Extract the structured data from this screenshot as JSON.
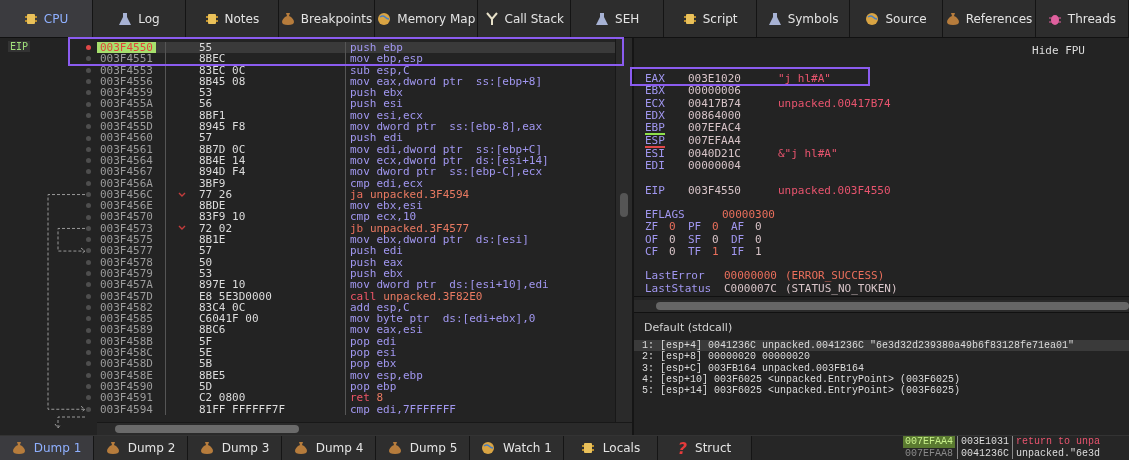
{
  "tabs": [
    {
      "label": "CPU",
      "selected": true
    },
    {
      "label": "Log",
      "selected": false
    },
    {
      "label": "Notes",
      "selected": false
    },
    {
      "label": "Breakpoints",
      "selected": false
    },
    {
      "label": "Memory Map",
      "selected": false
    },
    {
      "label": "Call Stack",
      "selected": false
    },
    {
      "label": "SEH",
      "selected": false
    },
    {
      "label": "Script",
      "selected": false
    },
    {
      "label": "Symbols",
      "selected": false
    },
    {
      "label": "Source",
      "selected": false
    },
    {
      "label": "References",
      "selected": false
    },
    {
      "label": "Threads",
      "selected": false
    }
  ],
  "disassembly": {
    "eip_label": "EIP",
    "rows": [
      {
        "address": "003F4550",
        "bytes": "55",
        "mnemonic": "push",
        "operands": "ebp",
        "kind": "plain",
        "breakpoint": true,
        "current": true,
        "jump_marker": false
      },
      {
        "address": "003F4551",
        "bytes": "8BEC",
        "mnemonic": "mov",
        "operands": "ebp,esp",
        "kind": "plain",
        "breakpoint": false,
        "current": false,
        "jump_marker": false
      },
      {
        "address": "003F4553",
        "bytes": "83EC 0C",
        "mnemonic": "sub",
        "operands": "esp,C",
        "kind": "plain",
        "breakpoint": false,
        "current": false,
        "jump_marker": false
      },
      {
        "address": "003F4556",
        "bytes": "8B45 08",
        "mnemonic": "mov",
        "operands": "eax,dword ptr  ss:[ebp+8]",
        "kind": "plain",
        "breakpoint": false,
        "current": false,
        "jump_marker": false
      },
      {
        "address": "003F4559",
        "bytes": "53",
        "mnemonic": "push",
        "operands": "ebx",
        "kind": "plain",
        "breakpoint": false,
        "current": false,
        "jump_marker": false
      },
      {
        "address": "003F455A",
        "bytes": "56",
        "mnemonic": "push",
        "operands": "esi",
        "kind": "plain",
        "breakpoint": false,
        "current": false,
        "jump_marker": false
      },
      {
        "address": "003F455B",
        "bytes": "8BF1",
        "mnemonic": "mov",
        "operands": "esi,ecx",
        "kind": "plain",
        "breakpoint": false,
        "current": false,
        "jump_marker": false
      },
      {
        "address": "003F455D",
        "bytes": "8945 F8",
        "mnemonic": "mov",
        "operands": "dword ptr  ss:[ebp-8],eax",
        "kind": "plain",
        "breakpoint": false,
        "current": false,
        "jump_marker": false
      },
      {
        "address": "003F4560",
        "bytes": "57",
        "mnemonic": "push",
        "operands": "edi",
        "kind": "plain",
        "breakpoint": false,
        "current": false,
        "jump_marker": false
      },
      {
        "address": "003F4561",
        "bytes": "8B7D 0C",
        "mnemonic": "mov",
        "operands": "edi,dword ptr  ss:[ebp+C]",
        "kind": "plain",
        "breakpoint": false,
        "current": false,
        "jump_marker": false
      },
      {
        "address": "003F4564",
        "bytes": "8B4E 14",
        "mnemonic": "mov",
        "operands": "ecx,dword ptr  ds:[esi+14]",
        "kind": "plain",
        "breakpoint": false,
        "current": false,
        "jump_marker": false
      },
      {
        "address": "003F4567",
        "bytes": "894D F4",
        "mnemonic": "mov",
        "operands": "dword ptr  ss:[ebp-C],ecx",
        "kind": "plain",
        "breakpoint": false,
        "current": false,
        "jump_marker": false
      },
      {
        "address": "003F456A",
        "bytes": "3BF9",
        "mnemonic": "cmp",
        "operands": "edi,ecx",
        "kind": "plain",
        "breakpoint": false,
        "current": false,
        "jump_marker": false
      },
      {
        "address": "003F456C",
        "bytes": "77 26",
        "mnemonic": "ja",
        "operands": "unpacked.3F4594",
        "kind": "jump",
        "breakpoint": false,
        "current": false,
        "jump_marker": true
      },
      {
        "address": "003F456E",
        "bytes": "8BDE",
        "mnemonic": "mov",
        "operands": "ebx,esi",
        "kind": "plain",
        "breakpoint": false,
        "current": false,
        "jump_marker": false
      },
      {
        "address": "003F4570",
        "bytes": "83F9 10",
        "mnemonic": "cmp",
        "operands": "ecx,10",
        "kind": "plain",
        "breakpoint": false,
        "current": false,
        "jump_marker": false
      },
      {
        "address": "003F4573",
        "bytes": "72 02",
        "mnemonic": "jb",
        "operands": "unpacked.3F4577",
        "kind": "jump",
        "breakpoint": false,
        "current": false,
        "jump_marker": true
      },
      {
        "address": "003F4575",
        "bytes": "8B1E",
        "mnemonic": "mov",
        "operands": "ebx,dword ptr  ds:[esi]",
        "kind": "plain",
        "breakpoint": false,
        "current": false,
        "jump_marker": false
      },
      {
        "address": "003F4577",
        "bytes": "57",
        "mnemonic": "push",
        "operands": "edi",
        "kind": "plain",
        "breakpoint": false,
        "current": false,
        "jump_marker": false
      },
      {
        "address": "003F4578",
        "bytes": "50",
        "mnemonic": "push",
        "operands": "eax",
        "kind": "plain",
        "breakpoint": false,
        "current": false,
        "jump_marker": false
      },
      {
        "address": "003F4579",
        "bytes": "53",
        "mnemonic": "push",
        "operands": "ebx",
        "kind": "plain",
        "breakpoint": false,
        "current": false,
        "jump_marker": false
      },
      {
        "address": "003F457A",
        "bytes": "897E 10",
        "mnemonic": "mov",
        "operands": "dword ptr  ds:[esi+10],edi",
        "kind": "plain",
        "breakpoint": false,
        "current": false,
        "jump_marker": false
      },
      {
        "address": "003F457D",
        "bytes": "E8 5E3D0000",
        "mnemonic": "call",
        "operands": "unpacked.3F82E0",
        "kind": "call",
        "breakpoint": false,
        "current": false,
        "jump_marker": false
      },
      {
        "address": "003F4582",
        "bytes": "83C4 0C",
        "mnemonic": "add",
        "operands": "esp,C",
        "kind": "plain",
        "breakpoint": false,
        "current": false,
        "jump_marker": false
      },
      {
        "address": "003F4585",
        "bytes": "C6041F 00",
        "mnemonic": "mov",
        "operands": "byte ptr  ds:[edi+ebx],0",
        "kind": "plain",
        "breakpoint": false,
        "current": false,
        "jump_marker": false
      },
      {
        "address": "003F4589",
        "bytes": "8BC6",
        "mnemonic": "mov",
        "operands": "eax,esi",
        "kind": "plain",
        "breakpoint": false,
        "current": false,
        "jump_marker": false
      },
      {
        "address": "003F458B",
        "bytes": "5F",
        "mnemonic": "pop",
        "operands": "edi",
        "kind": "plain",
        "breakpoint": false,
        "current": false,
        "jump_marker": false
      },
      {
        "address": "003F458C",
        "bytes": "5E",
        "mnemonic": "pop",
        "operands": "esi",
        "kind": "plain",
        "breakpoint": false,
        "current": false,
        "jump_marker": false
      },
      {
        "address": "003F458D",
        "bytes": "5B",
        "mnemonic": "pop",
        "operands": "ebx",
        "kind": "plain",
        "breakpoint": false,
        "current": false,
        "jump_marker": false
      },
      {
        "address": "003F458E",
        "bytes": "8BE5",
        "mnemonic": "mov",
        "operands": "esp,ebp",
        "kind": "plain",
        "breakpoint": false,
        "current": false,
        "jump_marker": false
      },
      {
        "address": "003F4590",
        "bytes": "5D",
        "mnemonic": "pop",
        "operands": "ebp",
        "kind": "plain",
        "breakpoint": false,
        "current": false,
        "jump_marker": false
      },
      {
        "address": "003F4591",
        "bytes": "C2 0800",
        "mnemonic": "ret",
        "operands": "8",
        "kind": "ret",
        "breakpoint": false,
        "current": false,
        "jump_marker": false
      },
      {
        "address": "003F4594",
        "bytes": "81FF FFFFFF7F",
        "mnemonic": "cmp",
        "operands": "edi,7FFFFFFF",
        "kind": "plain",
        "breakpoint": false,
        "current": false,
        "jump_marker": false
      }
    ]
  },
  "registers": {
    "hide_fpu": "Hide FPU",
    "general": [
      {
        "name": "EAX",
        "value": "003E1020",
        "comment": "\"j hl#A\""
      },
      {
        "name": "EBX",
        "value": "00000006"
      },
      {
        "name": "ECX",
        "value": "00417B74",
        "comment": "unpacked.00417B74"
      },
      {
        "name": "EDX",
        "value": "00864000"
      },
      {
        "name": "EBP",
        "value": "007EFAC4",
        "color": "#8ee04a"
      },
      {
        "name": "ESP",
        "value": "007EFAA4",
        "color": "#e04848"
      },
      {
        "name": "ESI",
        "value": "0040D21C",
        "comment": "&\"j hl#A\""
      },
      {
        "name": "EDI",
        "value": "00000004"
      }
    ],
    "eip": {
      "name": "EIP",
      "value": "003F4550",
      "comment": "unpacked.003F4550"
    },
    "eflags": {
      "name": "EFLAGS",
      "value": "00000300",
      "changed": true
    },
    "flags": [
      {
        "name": "ZF",
        "value": "0",
        "changed": true
      },
      {
        "name": "PF",
        "value": "0",
        "changed": true
      },
      {
        "name": "AF",
        "value": "0",
        "changed": false
      },
      {
        "name": "OF",
        "value": "0",
        "changed": false
      },
      {
        "name": "SF",
        "value": "0",
        "changed": false
      },
      {
        "name": "DF",
        "value": "0",
        "changed": false
      },
      {
        "name": "CF",
        "value": "0",
        "changed": false
      },
      {
        "name": "TF",
        "value": "1",
        "changed": true
      },
      {
        "name": "IF",
        "value": "1",
        "changed": false
      }
    ],
    "last": [
      {
        "name": "LastError",
        "value": "00000000",
        "comment": "(ERROR_SUCCESS)",
        "changed": true
      },
      {
        "name": "LastStatus",
        "value": "C000007C",
        "comment": "(STATUS_NO_TOKEN)",
        "changed": false
      }
    ]
  },
  "call_args": {
    "title": "Default (stdcall)",
    "lines": [
      {
        "text": "1: [esp+4] 0041236C unpacked.0041236C \"6e3d32d239380a49b6f83128fe71ea01\"",
        "selected": true
      },
      {
        "text": "2: [esp+8] 00000020 00000020",
        "selected": false
      },
      {
        "text": "3: [esp+C] 003FB164 unpacked.003FB164",
        "selected": false
      },
      {
        "text": "4: [esp+10] 003F6025 <unpacked.EntryPoint> (003F6025)",
        "selected": false
      },
      {
        "text": "5: [esp+14] 003F6025 <unpacked.EntryPoint> (003F6025)",
        "selected": false
      }
    ]
  },
  "bottom_tabs": [
    {
      "label": "Dump 1",
      "selected": true
    },
    {
      "label": "Dump 2",
      "selected": false
    },
    {
      "label": "Dump 3",
      "selected": false
    },
    {
      "label": "Dump 4",
      "selected": false
    },
    {
      "label": "Dump 5",
      "selected": false
    },
    {
      "label": "Watch 1",
      "selected": false
    },
    {
      "label": "Locals",
      "selected": false
    },
    {
      "label": "Struct",
      "selected": false,
      "glyph": "?"
    }
  ],
  "stack": [
    {
      "address": "007EFAA4",
      "value": "003E1031",
      "comment": "return to unpa",
      "selected": true
    },
    {
      "address": "007EFAA8",
      "value": "0041236C",
      "comment": "unpacked.\"6e3d",
      "selected": false
    }
  ]
}
